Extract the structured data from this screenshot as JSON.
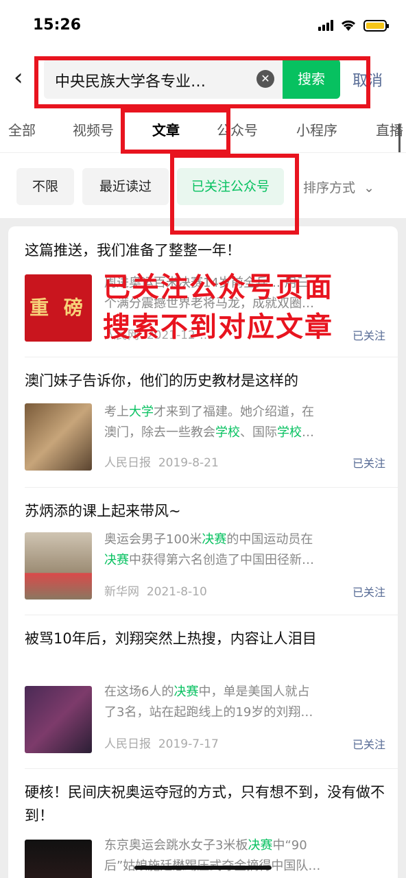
{
  "status_bar": {
    "time": "15:26"
  },
  "search": {
    "query": "中央民族大学各专业…",
    "search_label": "搜索",
    "cancel_label": "取消"
  },
  "tabs": [
    "全部",
    "视频号",
    "文章",
    "公众号",
    "小程序",
    "直播"
  ],
  "active_tab": "文章",
  "filters": [
    "不限",
    "最近读过",
    "已关注公众号"
  ],
  "selected_filter": "已关注公众号",
  "sort_label": "排序方式",
  "annotation_text": [
    "已关注公众号页面",
    "搜索不到对应文章"
  ],
  "colors": {
    "accent": "#07c160",
    "link": "#576b95",
    "annotation": "#e8141f"
  },
  "results": [
    {
      "title": "这篇推送，我们准备了整整一年！",
      "thumb_text": "重 磅",
      "snippet_lines": [
        "周进奥运百米决赛14岁前全乒… 用三",
        "个满分震撼世界老将马龙，成就双圈…"
      ],
      "source": "人民网",
      "date": "2021-12-…",
      "status": "已关注"
    },
    {
      "title": "澳门妹子告诉你，他们的历史教材是这样的",
      "snippet_lines": [
        "考上大学才来到了福建。她介绍道，在",
        "澳门，除去一些教会学校、国际学校…"
      ],
      "source": "人民日报",
      "date": "2019-8-21",
      "status": "已关注"
    },
    {
      "title": "苏炳添的课上起来带风~",
      "snippet_lines": [
        "奥运会男子100米决赛的中国运动员在",
        "决赛中获得第六名创造了中国田径新…"
      ],
      "source": "新华网",
      "date": "2021-8-10",
      "status": "已关注"
    },
    {
      "title": "被骂10年后，刘翔突然上热搜，内容让人泪目",
      "snippet_lines": [
        "在这场6人的决赛中，单是美国人就占",
        "了3名，站在起跑线上的19岁的刘翔…"
      ],
      "source": "人民日报",
      "date": "2019-7-17",
      "status": "已关注"
    },
    {
      "title": "硬核！民间庆祝奥运夺冠的方式，只有想不到，没有做不到！",
      "snippet_lines": [
        "东京奥运会跳水女子3米板决赛中“90",
        "后”姑娘施廷懋踢压式夺金摘得中国队…"
      ],
      "source": "",
      "date": "",
      "status": ""
    }
  ]
}
